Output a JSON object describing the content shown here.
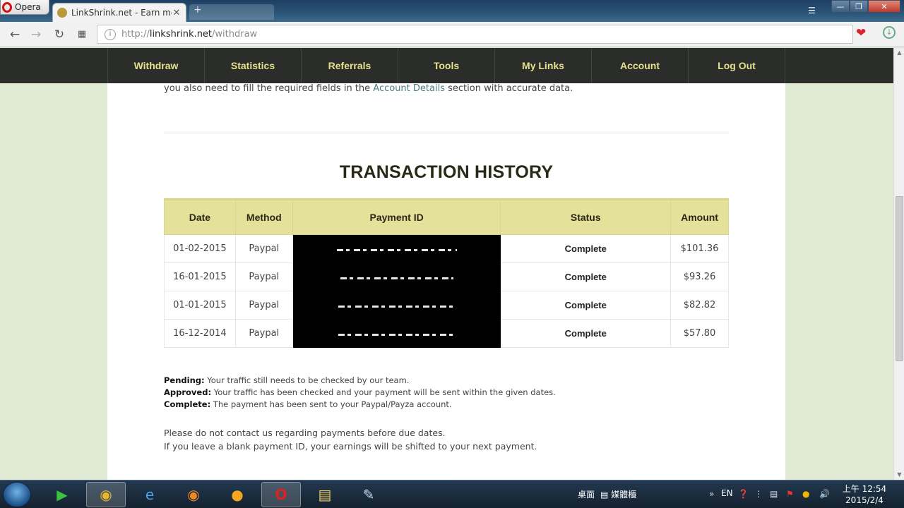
{
  "browser": {
    "menu_label": "Opera",
    "tab_title": "LinkShrink.net - Earn mor",
    "tab_close": "✕",
    "new_tab": "+",
    "url_prefix": "http://",
    "url_host": "linkshrink.net",
    "url_path": "/withdraw",
    "accent": "#d31212"
  },
  "nav": {
    "items": [
      "Withdraw",
      "Statistics",
      "Referrals",
      "Tools",
      "My Links",
      "Account",
      "Log Out"
    ],
    "text_color": "#e6e08d",
    "bg_color": "#2a2d29"
  },
  "intro": {
    "before": "you also need to fill the required fields in the ",
    "link": "Account Details",
    "after": " section with accurate data."
  },
  "heading": "TRANSACTION HISTORY",
  "table": {
    "headers": [
      "Date",
      "Method",
      "Payment ID",
      "Status",
      "Amount"
    ],
    "rows": [
      {
        "date": "01-02-2015",
        "method": "Paypal",
        "status": "Complete",
        "amount": "$101.36"
      },
      {
        "date": "16-01-2015",
        "method": "Paypal",
        "status": "Complete",
        "amount": "$93.26"
      },
      {
        "date": "01-01-2015",
        "method": "Paypal",
        "status": "Complete",
        "amount": "$82.82"
      },
      {
        "date": "16-12-2014",
        "method": "Paypal",
        "status": "Complete",
        "amount": "$57.80"
      }
    ],
    "header_bg": "#e4e29a"
  },
  "legend": {
    "pending_label": "Pending:",
    "pending_text": " Your traffic still needs to be checked by our team.",
    "approved_label": "Approved:",
    "approved_text": " Your traffic has been checked and your payment will be sent within the given dates.",
    "complete_label": "Complete:",
    "complete_text": " The payment has been sent to your Paypal/Payza account."
  },
  "notes": {
    "line1": "Please do not contact us regarding payments before due dates.",
    "line2": "If you leave a blank payment ID, your earnings will be shifted to your next payment."
  },
  "taskbar": {
    "desktop_label": "桌面",
    "folder_label": "媒體櫃",
    "lang": "EN",
    "time": "上午 12:54",
    "date": "2015/2/4"
  }
}
